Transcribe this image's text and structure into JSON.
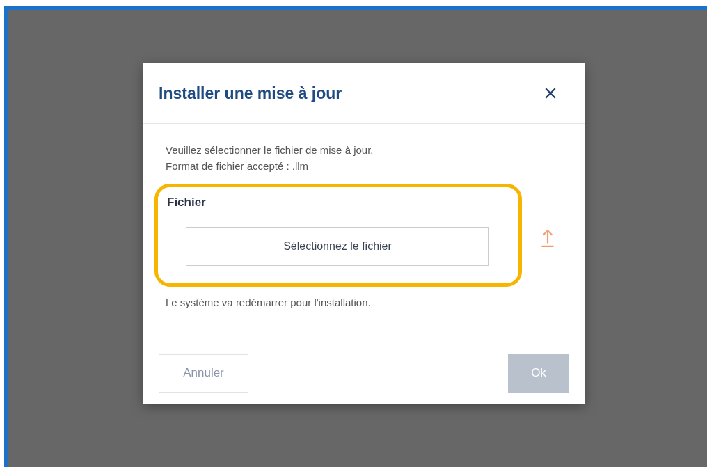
{
  "dialog": {
    "title": "Installer une mise à jour",
    "instructions": [
      "Veuillez sélectionner le fichier de mise à jour.",
      "Format de fichier accepté : .llm"
    ],
    "file_field": {
      "label": "Fichier",
      "button": "Sélectionnez le fichier",
      "highlighted": true
    },
    "note": "Le système va redémarrer pour l'installation.",
    "buttons": [
      {
        "label": "Annuler",
        "kind": "secondary",
        "disabled": false
      },
      {
        "label": "Ok",
        "kind": "primary",
        "disabled": true
      }
    ]
  }
}
